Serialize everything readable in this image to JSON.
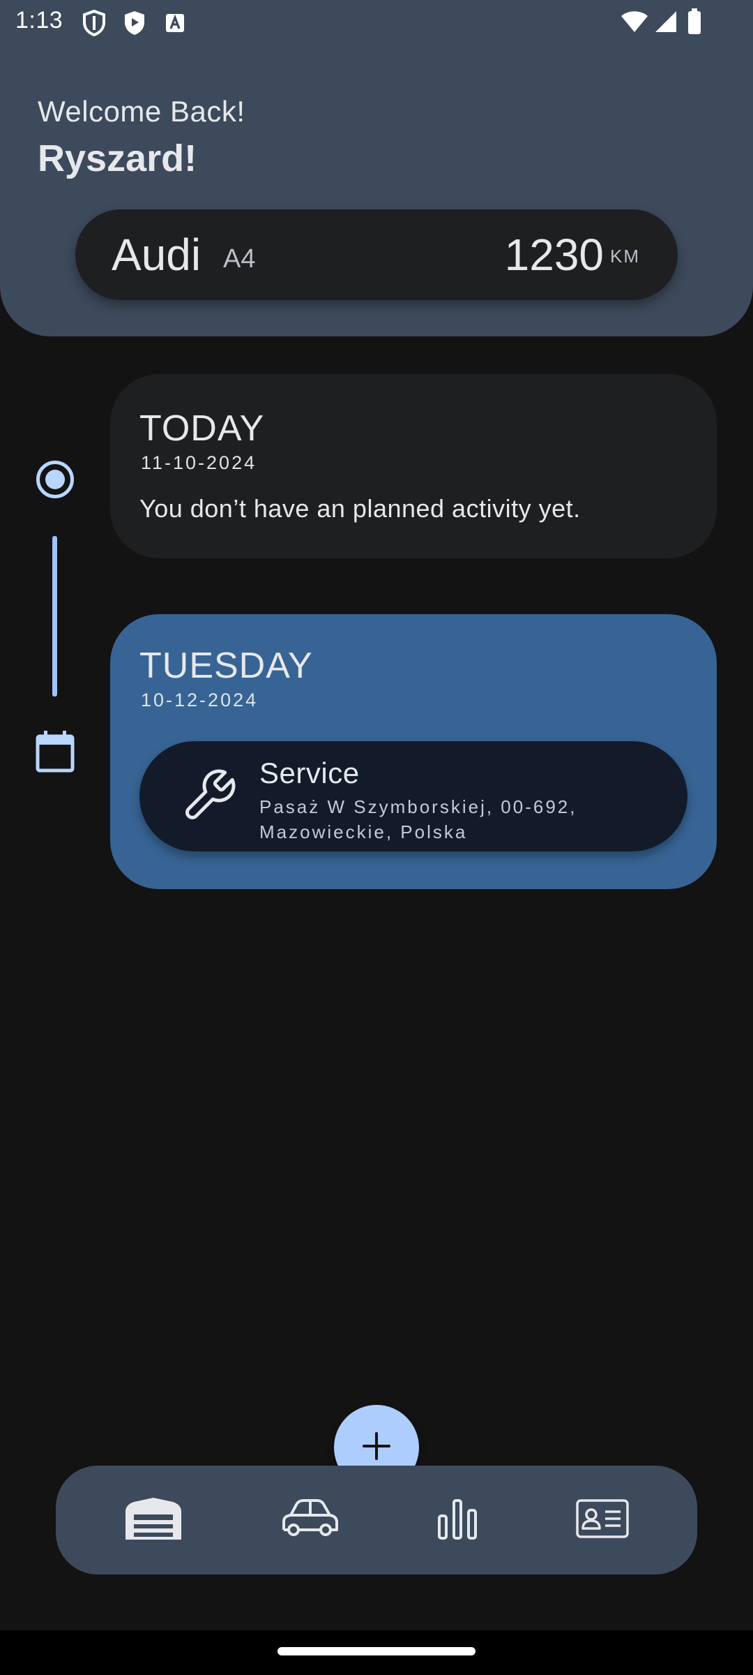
{
  "status_bar": {
    "time": "1:13"
  },
  "header": {
    "welcome": "Welcome Back!",
    "username": "Ryszard!"
  },
  "vehicle": {
    "make": "Audi",
    "model": "A4",
    "mileage": "1230",
    "mileage_unit": "KM"
  },
  "days": [
    {
      "title": "TODAY",
      "date": "11-10-2024",
      "empty_message": "You don’t have an planned activity yet."
    },
    {
      "title": "TUESDAY",
      "date": "10-12-2024",
      "activity": {
        "icon": "wrench-icon",
        "title": "Service",
        "address": "Pasaż W Szymborskiej, 00-692, Mazowieckie, Polska"
      }
    }
  ],
  "fab": {
    "icon": "plus-icon"
  },
  "bottom_nav": {
    "items": [
      {
        "icon": "garage-icon",
        "active": true
      },
      {
        "icon": "car-icon",
        "active": false
      },
      {
        "icon": "bar-chart-icon",
        "active": false
      },
      {
        "icon": "id-card-icon",
        "active": false
      }
    ]
  },
  "colors": {
    "background": "#131313",
    "header": "#3d4a5c",
    "card_dark": "#1e1f21",
    "card_accent": "#376494",
    "accent_light": "#aecdff",
    "text": "#e6e8ec"
  }
}
